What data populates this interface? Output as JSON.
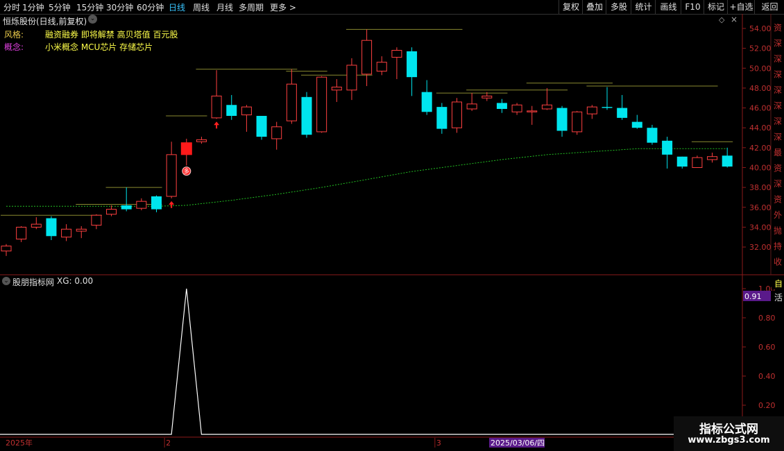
{
  "toolbar": {
    "periods": [
      {
        "label": "分时"
      },
      {
        "label": "1分钟"
      },
      {
        "label": "5分钟"
      },
      {
        "label": "15分钟"
      },
      {
        "label": "30分钟"
      },
      {
        "label": "60分钟"
      },
      {
        "label": "日线",
        "active": true
      },
      {
        "label": "周线"
      },
      {
        "label": "月线"
      },
      {
        "label": "多周期"
      },
      {
        "label": "更多 >"
      }
    ],
    "actions": [
      {
        "label": "复权"
      },
      {
        "label": "叠加"
      },
      {
        "label": "多股"
      },
      {
        "label": "统计"
      },
      {
        "label": "画线"
      },
      {
        "label": "F10"
      },
      {
        "label": "标记"
      },
      {
        "label": "+自选"
      },
      {
        "label": "返回"
      }
    ]
  },
  "stock": {
    "title": "恒烁股份(日线,前复权)",
    "style_label": "风格:",
    "style_value": "融资融券 即将解禁 高贝塔值 百元股",
    "concept_label": "概念:",
    "concept_value": "小米概念 MCU芯片 存储芯片"
  },
  "indicator": {
    "name": "股朋指标网",
    "xg_text": "XG: 0.00",
    "current_value_badge": "0.91",
    "signal_value": 1.0
  },
  "x_axis": {
    "year_label": "2025年",
    "month_labels": [
      {
        "label": "2",
        "index": 11
      },
      {
        "label": "3",
        "index": 29
      }
    ],
    "cursor_date": "2025/03/06/四"
  },
  "price_axis": {
    "ticks": [
      "54.00",
      "52.00",
      "50.00",
      "48.00",
      "46.00",
      "44.00",
      "42.00",
      "40.00",
      "38.00",
      "36.00",
      "34.00",
      "32.00"
    ],
    "range": [
      30.0,
      55.2
    ]
  },
  "indicator_axis": {
    "ticks": [
      "1.00",
      "0.80",
      "0.60",
      "0.40",
      "0.20"
    ],
    "range": [
      0.0,
      1.0
    ]
  },
  "right_sidebar_chars": [
    "资",
    "深",
    "深",
    "深",
    "深",
    "深",
    "深",
    "深",
    "最",
    "资",
    "深",
    "资",
    "外",
    "抛",
    "持",
    "收"
  ],
  "right_sidebar_chars_lower": [
    "自",
    "活"
  ],
  "chart_data": {
    "type": "candlestick",
    "candles": [
      {
        "o": 31.6,
        "c": 32.1,
        "h": 32.3,
        "l": 31.1
      },
      {
        "o": 32.8,
        "c": 34.0,
        "h": 34.1,
        "l": 32.5
      },
      {
        "o": 34.0,
        "c": 34.3,
        "h": 35.0,
        "l": 33.8
      },
      {
        "o": 34.9,
        "c": 33.1,
        "h": 35.1,
        "l": 32.7
      },
      {
        "o": 33.0,
        "c": 33.8,
        "h": 34.3,
        "l": 32.6
      },
      {
        "o": 33.6,
        "c": 33.8,
        "h": 34.1,
        "l": 32.9
      },
      {
        "o": 34.2,
        "c": 35.2,
        "h": 35.3,
        "l": 33.8
      },
      {
        "o": 35.3,
        "c": 35.8,
        "h": 36.2,
        "l": 35.1
      },
      {
        "o": 36.2,
        "c": 35.8,
        "h": 38.0,
        "l": 35.6
      },
      {
        "o": 35.9,
        "c": 36.6,
        "h": 36.9,
        "l": 35.7
      },
      {
        "o": 37.1,
        "c": 35.8,
        "h": 37.2,
        "l": 35.5
      },
      {
        "o": 37.1,
        "c": 41.3,
        "h": 42.6,
        "l": 36.9
      },
      {
        "o": 41.3,
        "c": 42.5,
        "h": 42.9,
        "l": 40.2
      },
      {
        "o": 42.6,
        "c": 42.8,
        "h": 43.1,
        "l": 42.4
      },
      {
        "o": 45.0,
        "c": 47.2,
        "h": 49.8,
        "l": 44.9
      },
      {
        "o": 46.3,
        "c": 45.2,
        "h": 47.3,
        "l": 44.8
      },
      {
        "o": 45.3,
        "c": 46.1,
        "h": 46.3,
        "l": 43.6
      },
      {
        "o": 45.2,
        "c": 43.1,
        "h": 45.2,
        "l": 42.8
      },
      {
        "o": 42.9,
        "c": 44.1,
        "h": 44.6,
        "l": 41.8
      },
      {
        "o": 44.7,
        "c": 48.4,
        "h": 49.9,
        "l": 44.4
      },
      {
        "o": 47.1,
        "c": 43.3,
        "h": 47.6,
        "l": 43.0
      },
      {
        "o": 43.6,
        "c": 49.1,
        "h": 49.2,
        "l": 43.5
      },
      {
        "o": 47.8,
        "c": 48.1,
        "h": 48.9,
        "l": 46.6
      },
      {
        "o": 47.8,
        "c": 50.3,
        "h": 51.0,
        "l": 46.8
      },
      {
        "o": 49.4,
        "c": 52.8,
        "h": 53.9,
        "l": 48.2
      },
      {
        "o": 49.7,
        "c": 50.6,
        "h": 51.2,
        "l": 49.3
      },
      {
        "o": 51.1,
        "c": 51.8,
        "h": 52.1,
        "l": 48.9
      },
      {
        "o": 51.7,
        "c": 49.1,
        "h": 52.1,
        "l": 47.2
      },
      {
        "o": 47.6,
        "c": 45.6,
        "h": 48.8,
        "l": 45.3
      },
      {
        "o": 46.1,
        "c": 43.9,
        "h": 46.5,
        "l": 43.4
      },
      {
        "o": 44.0,
        "c": 46.6,
        "h": 47.0,
        "l": 43.5
      },
      {
        "o": 45.9,
        "c": 46.4,
        "h": 47.5,
        "l": 45.7
      },
      {
        "o": 47.0,
        "c": 47.2,
        "h": 47.6,
        "l": 46.7
      },
      {
        "o": 46.5,
        "c": 45.9,
        "h": 46.9,
        "l": 45.5
      },
      {
        "o": 45.6,
        "c": 46.3,
        "h": 46.5,
        "l": 45.3
      },
      {
        "o": 45.6,
        "c": 45.7,
        "h": 46.2,
        "l": 44.3
      },
      {
        "o": 45.9,
        "c": 46.3,
        "h": 48.0,
        "l": 45.8
      },
      {
        "o": 46.0,
        "c": 43.7,
        "h": 46.2,
        "l": 43.1
      },
      {
        "o": 43.6,
        "c": 45.6,
        "h": 45.7,
        "l": 43.3
      },
      {
        "o": 45.4,
        "c": 46.1,
        "h": 46.3,
        "l": 44.9
      },
      {
        "o": 46.1,
        "c": 46.0,
        "h": 48.1,
        "l": 45.8
      },
      {
        "o": 46.0,
        "c": 45.0,
        "h": 47.3,
        "l": 44.8
      },
      {
        "o": 44.6,
        "c": 44.0,
        "h": 45.3,
        "l": 43.9
      },
      {
        "o": 44.0,
        "c": 42.5,
        "h": 44.3,
        "l": 42.3
      },
      {
        "o": 42.7,
        "c": 41.3,
        "h": 43.1,
        "l": 39.9
      },
      {
        "o": 41.1,
        "c": 40.1,
        "h": 41.1,
        "l": 39.9
      },
      {
        "o": 40.0,
        "c": 41.0,
        "h": 41.2,
        "l": 40.0
      },
      {
        "o": 40.8,
        "c": 41.1,
        "h": 41.5,
        "l": 40.5
      },
      {
        "o": 41.2,
        "c": 40.1,
        "h": 42.0,
        "l": 40.0
      }
    ],
    "ma_line": {
      "points": [
        [
          0,
          36.1
        ],
        [
          10,
          36.1
        ],
        [
          12,
          36.2
        ],
        [
          15,
          36.7
        ],
        [
          18,
          37.3
        ],
        [
          21,
          38.0
        ],
        [
          24,
          38.8
        ],
        [
          27,
          39.6
        ],
        [
          30,
          40.2
        ],
        [
          33,
          40.8
        ],
        [
          36,
          41.3
        ],
        [
          39,
          41.6
        ],
        [
          42,
          41.9
        ],
        [
          46,
          41.9
        ],
        [
          48,
          41.9
        ]
      ]
    },
    "resistance_lines": [
      {
        "from": 0,
        "to": 6,
        "price": 35.2
      },
      {
        "from": 5,
        "to": 10,
        "price": 36.3
      },
      {
        "from": 7,
        "to": 10,
        "price": 38.0
      },
      {
        "from": 11,
        "to": 13,
        "price": 45.2
      },
      {
        "from": 13,
        "to": 19,
        "price": 49.9
      },
      {
        "from": 19,
        "to": 21,
        "price": 49.7
      },
      {
        "from": 20,
        "to": 24,
        "price": 49.3
      },
      {
        "from": 23,
        "to": 30,
        "price": 53.9
      },
      {
        "from": 29,
        "to": 33,
        "price": 47.5
      },
      {
        "from": 31,
        "to": 37,
        "price": 47.8
      },
      {
        "from": 35,
        "to": 40,
        "price": 48.5
      },
      {
        "from": 39,
        "to": 47,
        "price": 48.2
      },
      {
        "from": 46,
        "to": 48,
        "price": 42.6
      }
    ],
    "buy_arrows": [
      11,
      14
    ],
    "signal_marker_index": 12,
    "indicator_values": {
      "spike_index": 12,
      "peak": 1.0,
      "baseline": 0.0
    }
  }
}
